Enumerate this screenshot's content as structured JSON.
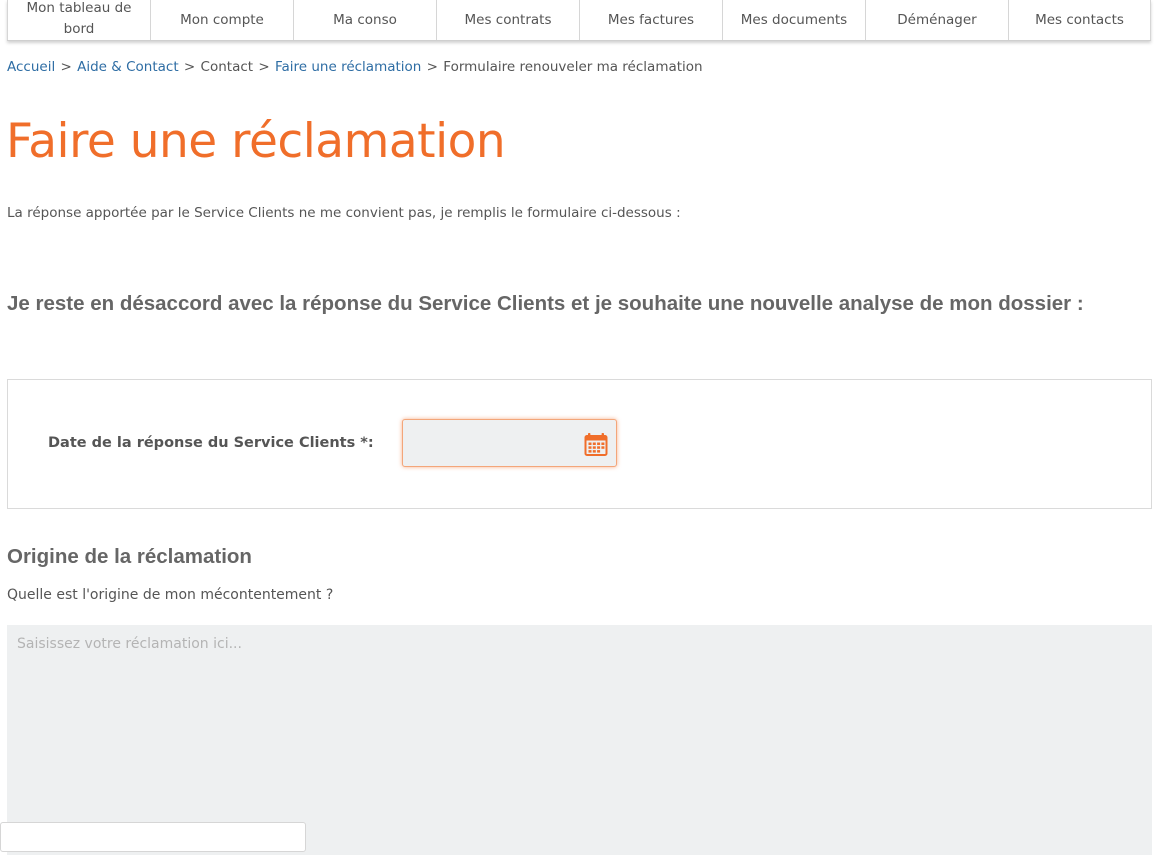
{
  "nav": {
    "items": [
      {
        "label": "Mon tableau de bord"
      },
      {
        "label": "Mon compte"
      },
      {
        "label": "Ma conso"
      },
      {
        "label": "Mes contrats"
      },
      {
        "label": "Mes factures"
      },
      {
        "label": "Mes documents"
      },
      {
        "label": "Déménager"
      },
      {
        "label": "Mes contacts"
      }
    ]
  },
  "breadcrumb": {
    "items": [
      {
        "label": "Accueil",
        "link": true
      },
      {
        "label": "Aide & Contact",
        "link": true
      },
      {
        "label": "Contact",
        "link": false
      },
      {
        "label": "Faire une réclamation",
        "link": true
      },
      {
        "label": "Formulaire renouveler ma réclamation",
        "link": false
      }
    ],
    "separator": ">"
  },
  "page": {
    "title": "Faire une réclamation",
    "intro": "La réponse apportée par le Service Clients ne me convient pas, je remplis le formulaire ci-dessous :",
    "section_heading": "Je reste en désaccord avec la réponse du Service Clients et je souhaite une nouvelle analyse de mon dossier :"
  },
  "date_panel": {
    "label": "Date de la réponse du Service Clients *:",
    "value": "",
    "icon": "calendar-icon"
  },
  "origin": {
    "heading": "Origine de la réclamation",
    "question": "Quelle est l'origine de mon mécontentement ?",
    "placeholder": "Saisissez votre réclamation ici...",
    "value": ""
  },
  "colors": {
    "accent": "#f06e2a",
    "link": "#2e6da4",
    "text": "#555555",
    "heading": "#666666",
    "field_background": "#eef0f1"
  }
}
